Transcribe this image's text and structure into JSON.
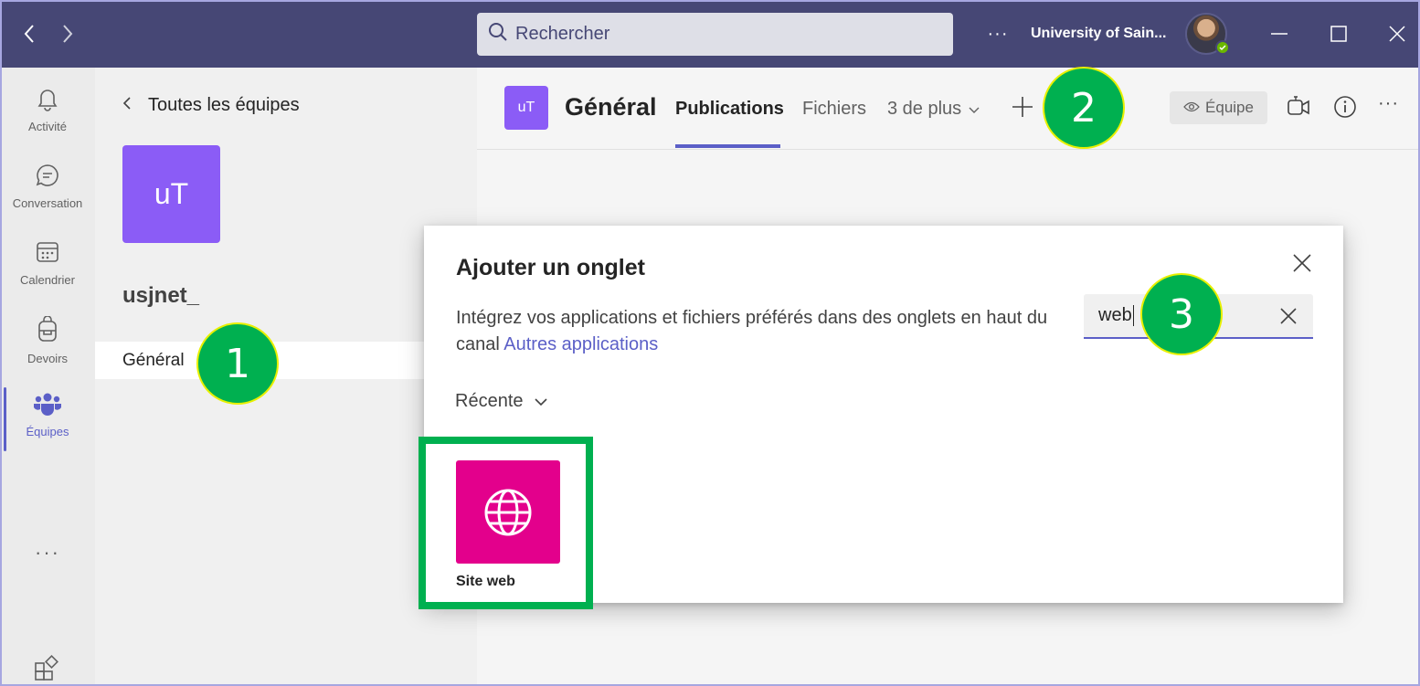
{
  "titlebar": {
    "search_placeholder": "Rechercher",
    "more": "···",
    "org_name": "University of Sain..."
  },
  "apprail": {
    "items": [
      {
        "label": "Activité",
        "icon": "bell-icon"
      },
      {
        "label": "Conversation",
        "icon": "chat-icon"
      },
      {
        "label": "Calendrier",
        "icon": "calendar-icon"
      },
      {
        "label": "Devoirs",
        "icon": "backpack-icon"
      },
      {
        "label": "Équipes",
        "icon": "teams-icon",
        "active": true
      }
    ],
    "more": "···"
  },
  "teampanel": {
    "back_label": "Toutes les équipes",
    "team_initials": "uT",
    "team_name": "usjnet_",
    "channel": "Général"
  },
  "header": {
    "channel_initials": "uT",
    "channel_title": "Général",
    "tabs": [
      "Publications",
      "Fichiers",
      "3 de plus"
    ],
    "team_button": "Équipe",
    "more": "···"
  },
  "dialog": {
    "title": "Ajouter un onglet",
    "description": "Intégrez vos applications et fichiers préférés dans des onglets en haut du canal",
    "link": "Autres applications",
    "search_value": "web",
    "filter_label": "Récente",
    "app_label": "Site web"
  },
  "steps": [
    "1",
    "2",
    "3"
  ],
  "colors": {
    "titlebar": "#464775",
    "accent": "#5b5fc7",
    "team_tile": "#8b5cf6",
    "app_tile": "#e3008c",
    "highlight": "#00b050",
    "step_border": "#e8f000"
  }
}
